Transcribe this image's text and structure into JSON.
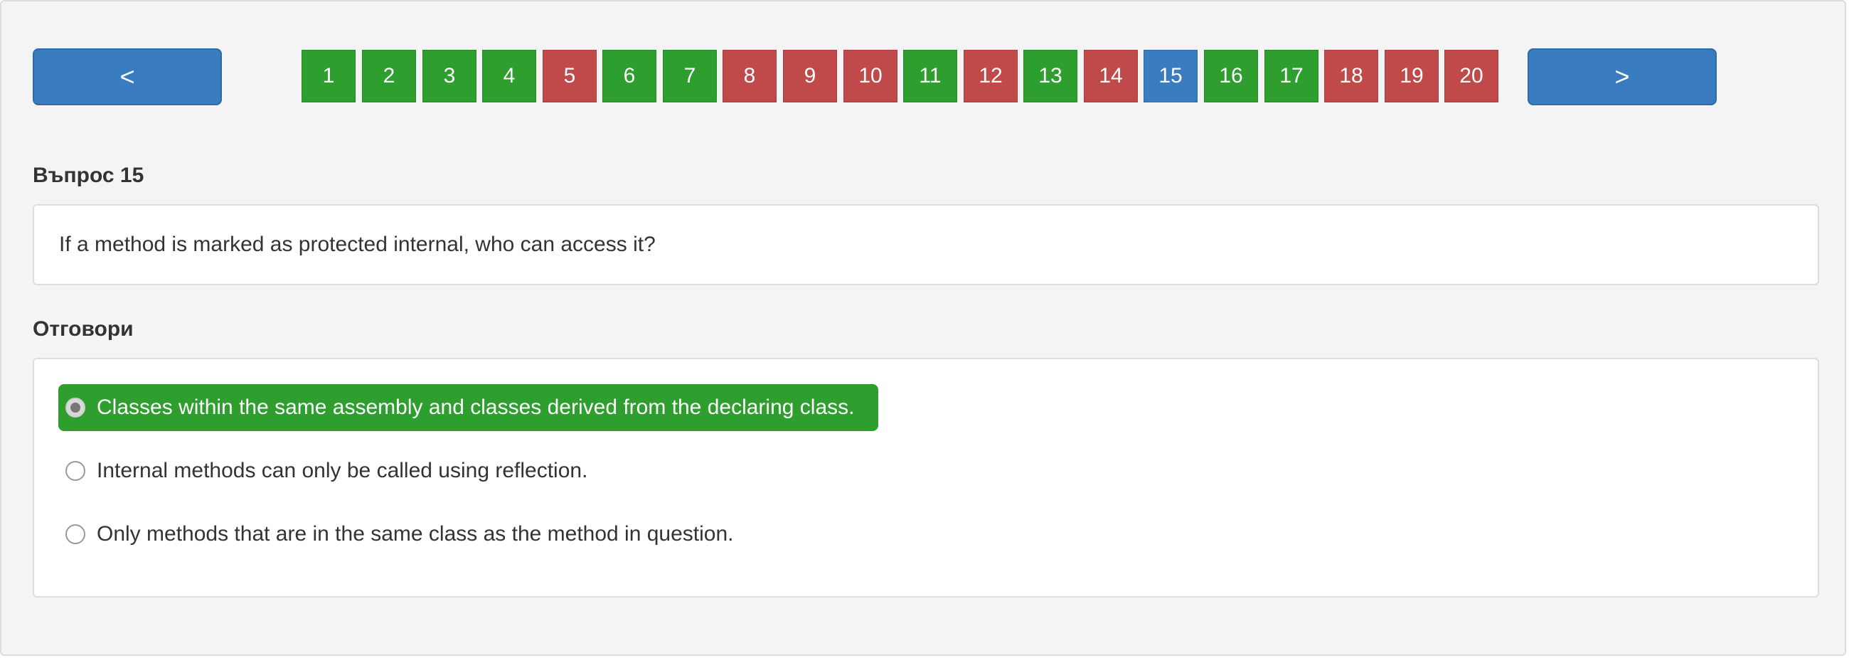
{
  "navigation": {
    "prev_label": "<",
    "next_label": ">"
  },
  "pager": {
    "pages": [
      {
        "label": "1",
        "status": "correct"
      },
      {
        "label": "2",
        "status": "correct"
      },
      {
        "label": "3",
        "status": "correct"
      },
      {
        "label": "4",
        "status": "correct"
      },
      {
        "label": "5",
        "status": "wrong"
      },
      {
        "label": "6",
        "status": "correct"
      },
      {
        "label": "7",
        "status": "correct"
      },
      {
        "label": "8",
        "status": "wrong"
      },
      {
        "label": "9",
        "status": "wrong"
      },
      {
        "label": "10",
        "status": "wrong"
      },
      {
        "label": "11",
        "status": "correct"
      },
      {
        "label": "12",
        "status": "wrong"
      },
      {
        "label": "13",
        "status": "correct"
      },
      {
        "label": "14",
        "status": "wrong"
      },
      {
        "label": "15",
        "status": "current"
      },
      {
        "label": "16",
        "status": "correct"
      },
      {
        "label": "17",
        "status": "correct"
      },
      {
        "label": "18",
        "status": "wrong"
      },
      {
        "label": "19",
        "status": "wrong"
      },
      {
        "label": "20",
        "status": "wrong"
      }
    ]
  },
  "question": {
    "heading": "Въпрос 15",
    "text": "If a method is marked as protected internal, who can access it?"
  },
  "answers": {
    "heading": "Отговори",
    "options": [
      {
        "text": "Classes within the same assembly and classes derived from the declaring class.",
        "selected": true
      },
      {
        "text": "Internal methods can only be called using reflection.",
        "selected": false
      },
      {
        "text": "Only methods that are in the same class as the method in question.",
        "selected": false
      }
    ]
  },
  "colors": {
    "correct": "#2e9e2e",
    "wrong": "#c0494a",
    "current": "#3a7cc0",
    "nav_button": "#3a7cc0"
  },
  "icons": {
    "radio": "radio-button-icon"
  }
}
